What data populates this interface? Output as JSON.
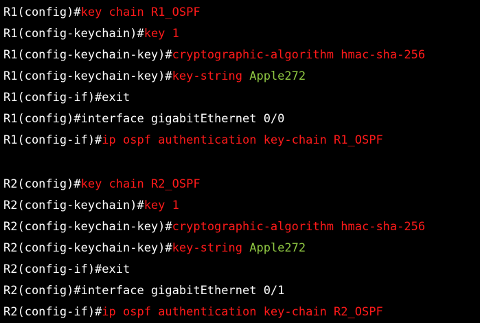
{
  "colors": {
    "background": "#000000",
    "prompt": "#ffffff",
    "command": "#ff1a1a",
    "argument": "#8fc742"
  },
  "lines": [
    {
      "prompt": "R1(config)#",
      "command": "key chain R1_OSPF",
      "arg": ""
    },
    {
      "prompt": "R1(config-keychain)#",
      "command": "key 1",
      "arg": ""
    },
    {
      "prompt": "R1(config-keychain-key)#",
      "command": "cryptographic-algorithm hmac-sha-256",
      "arg": ""
    },
    {
      "prompt": "R1(config-keychain-key)#",
      "command": "key-string ",
      "arg": "Apple272"
    },
    {
      "prompt": "R1(config-if)#exit",
      "command": "",
      "arg": ""
    },
    {
      "prompt": "R1(config)#interface gigabitEthernet 0/0",
      "command": "",
      "arg": ""
    },
    {
      "prompt": "R1(config-if)#",
      "command": "ip ospf authentication key-chain R1_OSPF",
      "arg": ""
    },
    {
      "prompt": "R2(config)#",
      "command": "key chain R2_OSPF",
      "arg": ""
    },
    {
      "prompt": "R2(config-keychain)#",
      "command": "key 1",
      "arg": ""
    },
    {
      "prompt": "R2(config-keychain-key)#",
      "command": "cryptographic-algorithm hmac-sha-256",
      "arg": ""
    },
    {
      "prompt": "R2(config-keychain-key)#",
      "command": "key-string ",
      "arg": "Apple272"
    },
    {
      "prompt": "R2(config-if)#exit",
      "command": "",
      "arg": ""
    },
    {
      "prompt": "R2(config)#interface gigabitEthernet 0/1",
      "command": "",
      "arg": ""
    },
    {
      "prompt": "R2(config-if)#",
      "command": "ip ospf authentication key-chain R2_OSPF",
      "arg": ""
    }
  ]
}
